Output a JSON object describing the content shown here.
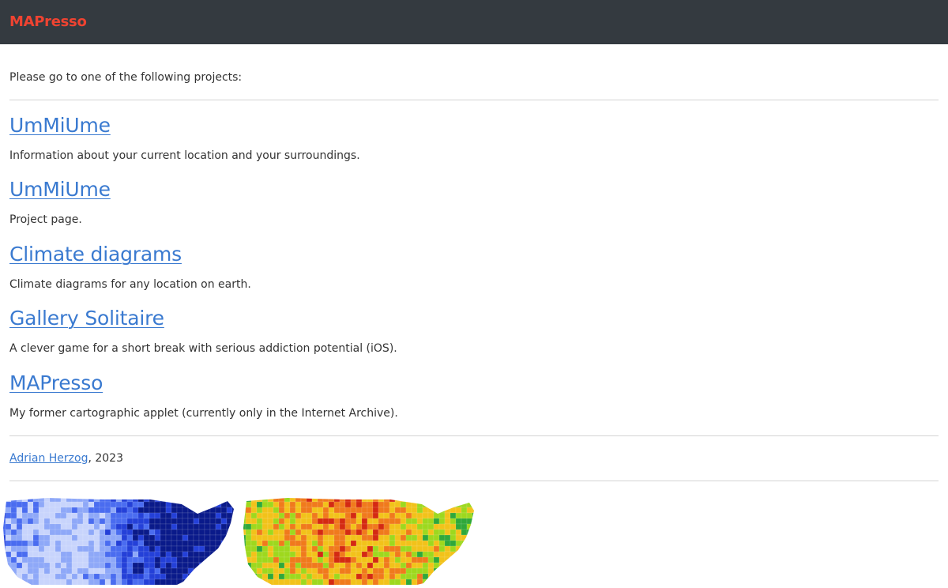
{
  "header": {
    "brand": "MAPresso",
    "brand_color": "#ef4331",
    "background": "#343a40"
  },
  "intro": "Please go to one of the following projects:",
  "projects": [
    {
      "title": "UmMiUme",
      "description": "Information about your current location and your surroundings."
    },
    {
      "title": "UmMiUme",
      "description": "Project page."
    },
    {
      "title": "Climate diagrams",
      "description": "Climate diagrams for any location on earth."
    },
    {
      "title": "Gallery Solitaire",
      "description": "A clever game for a short break with serious addiction potential (iOS)."
    },
    {
      "title": "MAPresso",
      "description": "My former cartographic applet (currently only in the Internet Archive)."
    }
  ],
  "footer": {
    "author": "Adrian Herzog",
    "suffix": ", 2023"
  },
  "images": [
    {
      "name": "us-county-map-blue",
      "palette": [
        "#0a1a8a",
        "#2440d8",
        "#4a6cf0",
        "#8ea8f8",
        "#c8d4fc"
      ]
    },
    {
      "name": "us-county-map-redgreen",
      "palette": [
        "#d42a12",
        "#f07a1c",
        "#f2c21a",
        "#9ed81e",
        "#2fa83a"
      ]
    }
  ],
  "link_color": "#3a7ad0"
}
